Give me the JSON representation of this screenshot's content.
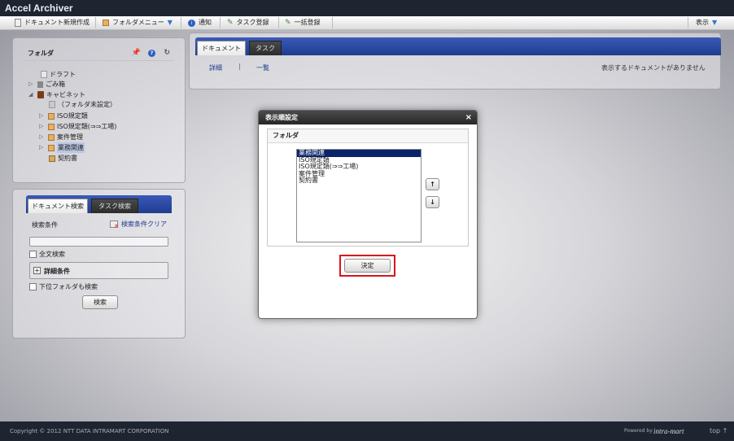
{
  "app": {
    "title": "Accel Archiver"
  },
  "menubar": {
    "items": [
      "ドキュメント新規作成",
      "フォルダメニュー",
      "通知",
      "タスク登録",
      "一括登録"
    ],
    "right": "表示"
  },
  "folder_panel": {
    "title": "フォルダ",
    "tree": [
      {
        "label": "ドラフト",
        "toggle": ""
      },
      {
        "label": "ごみ箱",
        "toggle": "▷"
      },
      {
        "label": "キャビネット",
        "toggle": "◢"
      },
      {
        "label": "（フォルダ未設定）",
        "toggle": ""
      },
      {
        "label": "ISO規定類",
        "toggle": "▷"
      },
      {
        "label": "ISO規定類(⇒⇒工場)",
        "toggle": "▷"
      },
      {
        "label": "案件管理",
        "toggle": "▷"
      },
      {
        "label": "業務関連",
        "toggle": "▷"
      },
      {
        "label": "契約書",
        "toggle": ""
      }
    ]
  },
  "search_panel": {
    "tabs": [
      "ドキュメント検索",
      "タスク検索"
    ],
    "condition_label": "検索条件",
    "clear_link": "検索条件クリア",
    "search_value": "",
    "fulltext_label": "全文検索",
    "detail_label": "詳細条件",
    "subfolder_label": "下位フォルダも検索",
    "search_button": "検索"
  },
  "doc_panel": {
    "tabs": [
      "ドキュメント",
      "タスク"
    ],
    "links": [
      "詳細",
      "一覧"
    ],
    "divider": "|",
    "empty_message": "表示するドキュメントがありません"
  },
  "dialog": {
    "title": "表示順設定",
    "close": "×",
    "legend": "フォルダ",
    "list": [
      "業務関連",
      "ISO規定類",
      "ISO規定類(⇒⇒工場)",
      "案件管理",
      "契約書"
    ],
    "selected_index": 0,
    "up": "↑",
    "down": "↓",
    "ok_button": "決定"
  },
  "footer": {
    "copyright": "Copyright © 2012 NTT DATA INTRAMART CORPORATION",
    "powered": "Powered by",
    "brand": "intra-mart",
    "top_link": "top ↑"
  },
  "colors": {
    "highlight": "#d9141b",
    "selection": "#0a246a",
    "accent": "#1f3c8f"
  }
}
